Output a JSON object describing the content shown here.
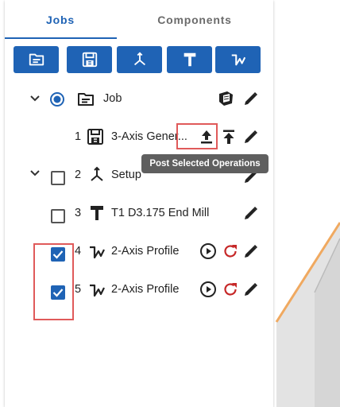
{
  "tabs": {
    "jobs": "Jobs",
    "components": "Components"
  },
  "toolbar": [
    {
      "icon": "folder-icon"
    },
    {
      "icon": "save-icon"
    },
    {
      "icon": "axis-icon"
    },
    {
      "icon": "tool-icon"
    },
    {
      "icon": "toolpath-icon"
    }
  ],
  "rows": {
    "job": {
      "label": "Job"
    },
    "program": {
      "number": "1",
      "label": "3-Axis Gener..."
    },
    "setup": {
      "number": "2",
      "label": "Setup"
    },
    "tool": {
      "number": "3",
      "label": "T1 D3.175 End Mill"
    },
    "op4": {
      "number": "4",
      "label": "2-Axis Profile",
      "checked": true
    },
    "op5": {
      "number": "5",
      "label": "2-Axis Profile",
      "checked": true
    }
  },
  "tooltip": "Post Selected Operations",
  "colors": {
    "accent": "#1f63b5",
    "highlight": "#e05a5a",
    "refresh": "#c62828",
    "tooltip_bg": "#5f5f5f"
  }
}
